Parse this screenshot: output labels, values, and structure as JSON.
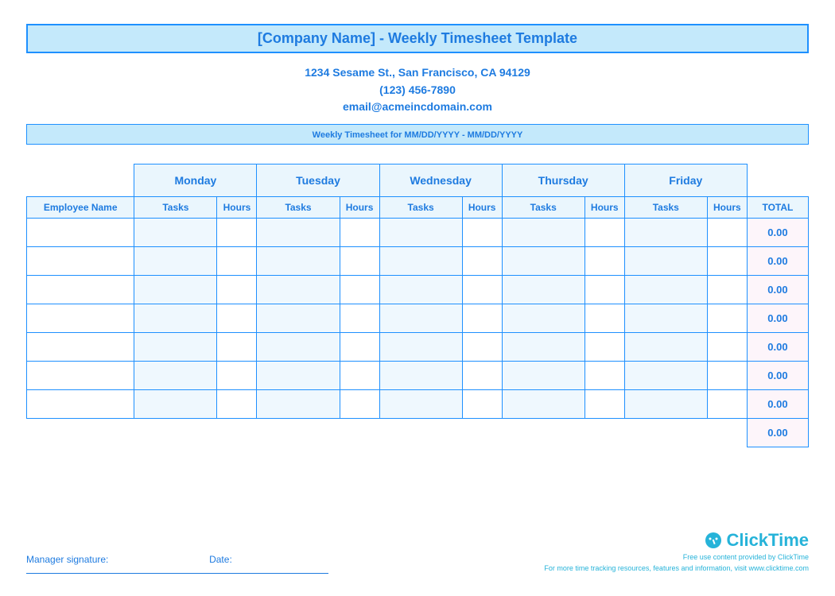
{
  "header": {
    "title": "[Company Name] - Weekly Timesheet Template",
    "address": "1234 Sesame St.,  San Francisco, CA 94129",
    "phone": "(123) 456-7890",
    "email": "email@acmeincdomain.com",
    "week_label": "Weekly Timesheet for MM/DD/YYYY - MM/DD/YYYY"
  },
  "table": {
    "days": [
      "Monday",
      "Tuesday",
      "Wednesday",
      "Thursday",
      "Friday"
    ],
    "employee_header": "Employee Name",
    "tasks_header": "Tasks",
    "hours_header": "Hours",
    "total_header": "TOTAL",
    "rows": [
      {
        "employee": "",
        "mon_t": "",
        "mon_h": "",
        "tue_t": "",
        "tue_h": "",
        "wed_t": "",
        "wed_h": "",
        "thu_t": "",
        "thu_h": "",
        "fri_t": "",
        "fri_h": "",
        "total": "0.00"
      },
      {
        "employee": "",
        "mon_t": "",
        "mon_h": "",
        "tue_t": "",
        "tue_h": "",
        "wed_t": "",
        "wed_h": "",
        "thu_t": "",
        "thu_h": "",
        "fri_t": "",
        "fri_h": "",
        "total": "0.00"
      },
      {
        "employee": "",
        "mon_t": "",
        "mon_h": "",
        "tue_t": "",
        "tue_h": "",
        "wed_t": "",
        "wed_h": "",
        "thu_t": "",
        "thu_h": "",
        "fri_t": "",
        "fri_h": "",
        "total": "0.00"
      },
      {
        "employee": "",
        "mon_t": "",
        "mon_h": "",
        "tue_t": "",
        "tue_h": "",
        "wed_t": "",
        "wed_h": "",
        "thu_t": "",
        "thu_h": "",
        "fri_t": "",
        "fri_h": "",
        "total": "0.00"
      },
      {
        "employee": "",
        "mon_t": "",
        "mon_h": "",
        "tue_t": "",
        "tue_h": "",
        "wed_t": "",
        "wed_h": "",
        "thu_t": "",
        "thu_h": "",
        "fri_t": "",
        "fri_h": "",
        "total": "0.00"
      },
      {
        "employee": "",
        "mon_t": "",
        "mon_h": "",
        "tue_t": "",
        "tue_h": "",
        "wed_t": "",
        "wed_h": "",
        "thu_t": "",
        "thu_h": "",
        "fri_t": "",
        "fri_h": "",
        "total": "0.00"
      },
      {
        "employee": "",
        "mon_t": "",
        "mon_h": "",
        "tue_t": "",
        "tue_h": "",
        "wed_t": "",
        "wed_h": "",
        "thu_t": "",
        "thu_h": "",
        "fri_t": "",
        "fri_h": "",
        "total": "0.00"
      }
    ],
    "grand_total": "0.00"
  },
  "footer": {
    "signature_label": "Manager signature:",
    "date_label": "Date:",
    "brand_name": "ClickTime",
    "brand_line1": "Free use content provided by ClickTime",
    "brand_line2": "For more time tracking resources, features and information, visit www.clicktime.com"
  }
}
